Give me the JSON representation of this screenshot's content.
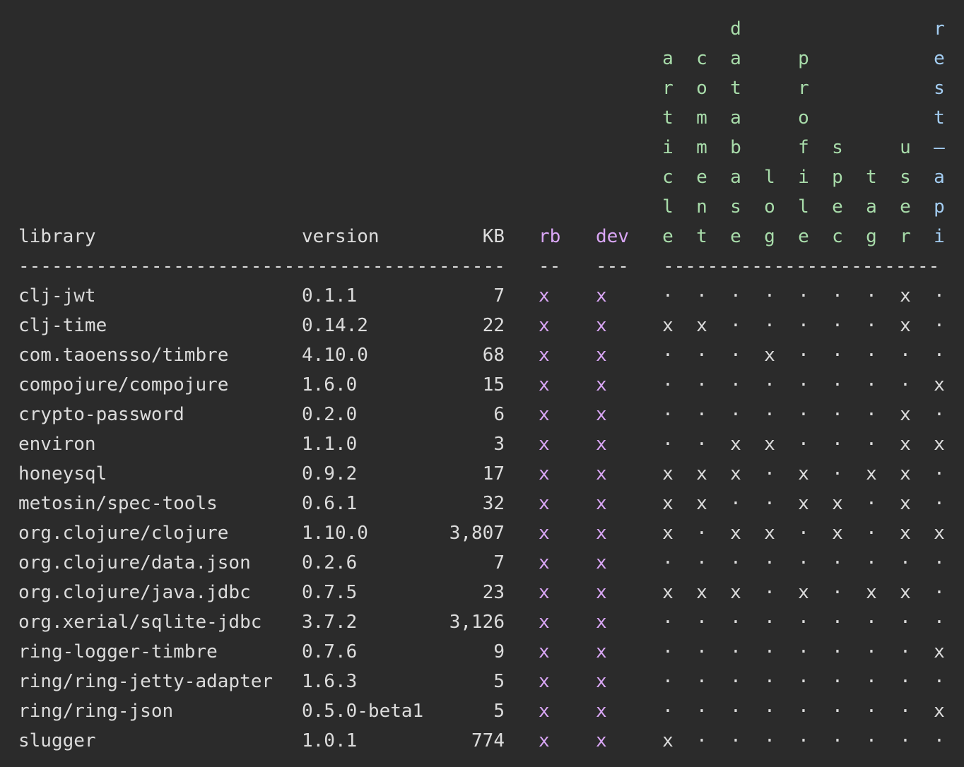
{
  "headers": {
    "library": "library",
    "version": "version",
    "kb": "KB",
    "rb": "rb",
    "dev": "dev"
  },
  "separators": {
    "main": "--------------------------------------------",
    "rb": "--",
    "dev": "---",
    "modules": "-------------------------"
  },
  "modules": [
    {
      "name": "article",
      "color": "#a8dcaa"
    },
    {
      "name": "comment",
      "color": "#a8dcaa"
    },
    {
      "name": "database",
      "color": "#a8dcaa"
    },
    {
      "name": "log",
      "color": "#a8dcaa"
    },
    {
      "name": "profile",
      "color": "#a8dcaa"
    },
    {
      "name": "spec",
      "color": "#a8dcaa"
    },
    {
      "name": "tag",
      "color": "#a8dcaa"
    },
    {
      "name": "user",
      "color": "#a8dcaa"
    },
    {
      "name": "rest-api",
      "color": "#a3cdf2"
    }
  ],
  "rows": [
    {
      "library": "clj-jwt",
      "version": "0.1.1",
      "kb": "7",
      "rb": "x",
      "dev": "x",
      "mods": [
        "·",
        "·",
        "·",
        "·",
        "·",
        "·",
        "·",
        "x",
        "·"
      ]
    },
    {
      "library": "clj-time",
      "version": "0.14.2",
      "kb": "22",
      "rb": "x",
      "dev": "x",
      "mods": [
        "x",
        "x",
        "·",
        "·",
        "·",
        "·",
        "·",
        "x",
        "·"
      ]
    },
    {
      "library": "com.taoensso/timbre",
      "version": "4.10.0",
      "kb": "68",
      "rb": "x",
      "dev": "x",
      "mods": [
        "·",
        "·",
        "·",
        "x",
        "·",
        "·",
        "·",
        "·",
        "·"
      ]
    },
    {
      "library": "compojure/compojure",
      "version": "1.6.0",
      "kb": "15",
      "rb": "x",
      "dev": "x",
      "mods": [
        "·",
        "·",
        "·",
        "·",
        "·",
        "·",
        "·",
        "·",
        "x"
      ]
    },
    {
      "library": "crypto-password",
      "version": "0.2.0",
      "kb": "6",
      "rb": "x",
      "dev": "x",
      "mods": [
        "·",
        "·",
        "·",
        "·",
        "·",
        "·",
        "·",
        "x",
        "·"
      ]
    },
    {
      "library": "environ",
      "version": "1.1.0",
      "kb": "3",
      "rb": "x",
      "dev": "x",
      "mods": [
        "·",
        "·",
        "x",
        "x",
        "·",
        "·",
        "·",
        "x",
        "x"
      ]
    },
    {
      "library": "honeysql",
      "version": "0.9.2",
      "kb": "17",
      "rb": "x",
      "dev": "x",
      "mods": [
        "x",
        "x",
        "x",
        "·",
        "x",
        "·",
        "x",
        "x",
        "·"
      ]
    },
    {
      "library": "metosin/spec-tools",
      "version": "0.6.1",
      "kb": "32",
      "rb": "x",
      "dev": "x",
      "mods": [
        "x",
        "x",
        "·",
        "·",
        "x",
        "x",
        "·",
        "x",
        "·"
      ]
    },
    {
      "library": "org.clojure/clojure",
      "version": "1.10.0",
      "kb": "3,807",
      "rb": "x",
      "dev": "x",
      "mods": [
        "x",
        "·",
        "x",
        "x",
        "·",
        "x",
        "·",
        "x",
        "x"
      ]
    },
    {
      "library": "org.clojure/data.json",
      "version": "0.2.6",
      "kb": "7",
      "rb": "x",
      "dev": "x",
      "mods": [
        "·",
        "·",
        "·",
        "·",
        "·",
        "·",
        "·",
        "·",
        "·"
      ]
    },
    {
      "library": "org.clojure/java.jdbc",
      "version": "0.7.5",
      "kb": "23",
      "rb": "x",
      "dev": "x",
      "mods": [
        "x",
        "x",
        "x",
        "·",
        "x",
        "·",
        "x",
        "x",
        "·"
      ]
    },
    {
      "library": "org.xerial/sqlite-jdbc",
      "version": "3.7.2",
      "kb": "3,126",
      "rb": "x",
      "dev": "x",
      "mods": [
        "·",
        "·",
        "·",
        "·",
        "·",
        "·",
        "·",
        "·",
        "·"
      ]
    },
    {
      "library": "ring-logger-timbre",
      "version": "0.7.6",
      "kb": "9",
      "rb": "x",
      "dev": "x",
      "mods": [
        "·",
        "·",
        "·",
        "·",
        "·",
        "·",
        "·",
        "·",
        "x"
      ]
    },
    {
      "library": "ring/ring-jetty-adapter",
      "version": "1.6.3",
      "kb": "5",
      "rb": "x",
      "dev": "x",
      "mods": [
        "·",
        "·",
        "·",
        "·",
        "·",
        "·",
        "·",
        "·",
        "·"
      ]
    },
    {
      "library": "ring/ring-json",
      "version": "0.5.0-beta1",
      "kb": "5",
      "rb": "x",
      "dev": "x",
      "mods": [
        "·",
        "·",
        "·",
        "·",
        "·",
        "·",
        "·",
        "·",
        "x"
      ]
    },
    {
      "library": "slugger",
      "version": "1.0.1",
      "kb": "774",
      "rb": "x",
      "dev": "x",
      "mods": [
        "x",
        "·",
        "·",
        "·",
        "·",
        "·",
        "·",
        "·",
        "·"
      ]
    }
  ]
}
